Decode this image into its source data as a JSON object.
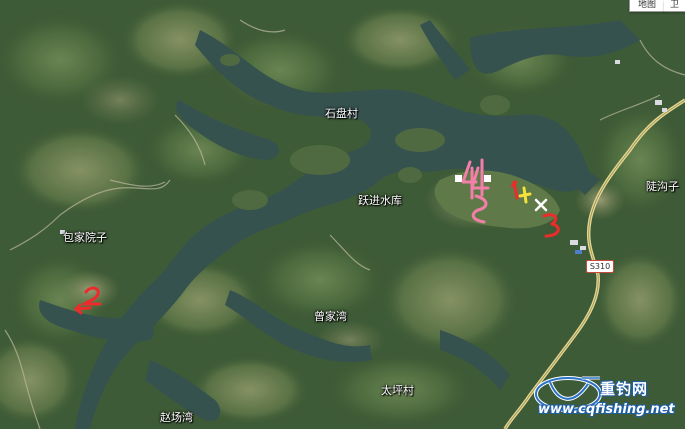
{
  "map_type_control": {
    "map_label": "地图",
    "satellite_label": "卫"
  },
  "place_labels": {
    "shipan_village": "石盘村",
    "yuejin_reservoir": "跃进水库",
    "baojia_courtyard": "包家院子",
    "zengjia_bay": "曾家湾",
    "taiping_village": "太坪村",
    "zhaochang_bay": "赵场湾",
    "dougou": "陡沟子"
  },
  "road_shield": "S310",
  "annotations": {
    "mark_1": "1",
    "mark_2": "2",
    "mark_3": "3",
    "mark_4": "4"
  },
  "colors": {
    "water": "#36524f",
    "land": "#3e5b37",
    "road": "#d9cf8e",
    "pink_marker": "#f27fa8",
    "red_marker": "#ee2b2b",
    "yellow_marker": "#f4e13a",
    "white_marker": "#ffffff"
  },
  "watermark": {
    "site_name": "重钓网",
    "url": "www.cqfishing.net"
  }
}
